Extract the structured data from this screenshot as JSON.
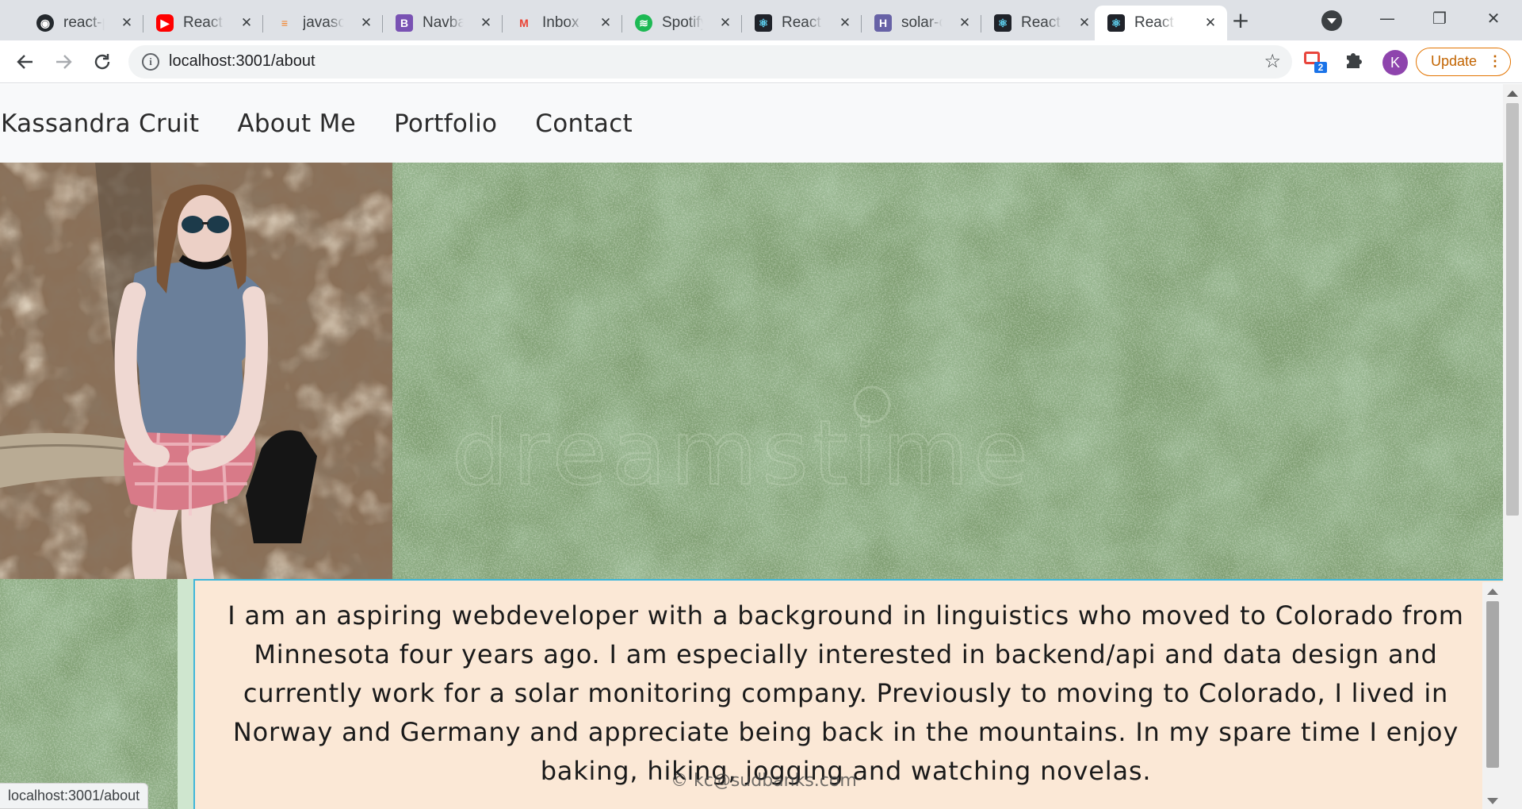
{
  "browser": {
    "tabs": [
      {
        "title": "react-p",
        "icon": "github-icon",
        "color": "#24292e"
      },
      {
        "title": "React V",
        "icon": "youtube-icon",
        "color": "#ff0000"
      },
      {
        "title": "javascri",
        "icon": "stackoverflow-icon",
        "color": "#f48024"
      },
      {
        "title": "Navbar",
        "icon": "bootstrap-icon",
        "color": "#7952b3"
      },
      {
        "title": "Inbox (",
        "icon": "gmail-icon",
        "color": "#ea4335"
      },
      {
        "title": "Spotify",
        "icon": "spotify-icon",
        "color": "#1db954"
      },
      {
        "title": "React F",
        "icon": "react-icon",
        "color": "#61dafb"
      },
      {
        "title": "solar-c",
        "icon": "heroku-icon",
        "color": "#6762a6"
      },
      {
        "title": "React F",
        "icon": "react-icon",
        "color": "#61dafb"
      },
      {
        "title": "React F",
        "icon": "react-icon",
        "color": "#61dafb",
        "active": true
      }
    ],
    "new_tab": "+",
    "window_controls": {
      "minimize": "—",
      "restore": "❐",
      "close": "✕"
    },
    "address": {
      "url": "localhost:3001/about"
    },
    "extension_badge_count": "2",
    "profile_initial": "K",
    "update_label": "Update",
    "accent_update": "#e37400"
  },
  "site": {
    "brand": "Kassandra Cruit",
    "nav": [
      "About Me",
      "Portfolio",
      "Contact"
    ],
    "bio": "I am an aspiring webdeveloper with a background in linguistics who moved to Colorado from Minnesota four years ago. I am especially interested in backend/api and data design and currently work for a solar monitoring company. Previously to moving to Colorado, I lived in Norway and Germany and appreciate being back in the mountains. In my spare time I enjoy baking, hiking, jogging and watching novelas.",
    "footer_email": "© kc@sudbanks.com",
    "watermark": "dreamstime",
    "colors": {
      "bio_bg": "#fbe8d6",
      "bio_border": "#3fb6d9",
      "navbar_bg": "#f8f9fa",
      "texture": "#7f9e72"
    }
  },
  "status_url": "localhost:3001/about"
}
